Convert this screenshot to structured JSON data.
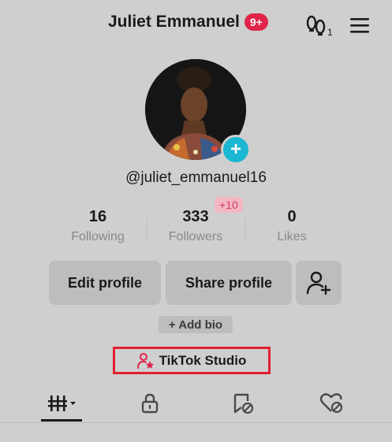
{
  "header": {
    "title": "Juliet Emmanuel",
    "notification_badge": "9+",
    "friends_count": "1"
  },
  "profile": {
    "username": "@juliet_emmanuel16",
    "stats": [
      {
        "value": "16",
        "label": "Following"
      },
      {
        "value": "333",
        "label": "Followers"
      },
      {
        "value": "0",
        "label": "Likes"
      }
    ],
    "new_followers": "+10"
  },
  "actions": {
    "edit_profile": "Edit profile",
    "share_profile": "Share profile",
    "add_bio": "+ Add bio",
    "tiktok_studio": "TikTok Studio"
  },
  "tabs": [
    {
      "icon": "videos-grid-icon",
      "active": true
    },
    {
      "icon": "lock-icon",
      "active": false
    },
    {
      "icon": "reposts-icon",
      "active": false
    },
    {
      "icon": "liked-hidden-icon",
      "active": false
    }
  ],
  "colors": {
    "background": "#cfcfcf",
    "badge": "#e0244a",
    "avatar_add": "#1cb7d3",
    "highlight_box": "#e02030",
    "studio_icon": "#e0244a"
  }
}
